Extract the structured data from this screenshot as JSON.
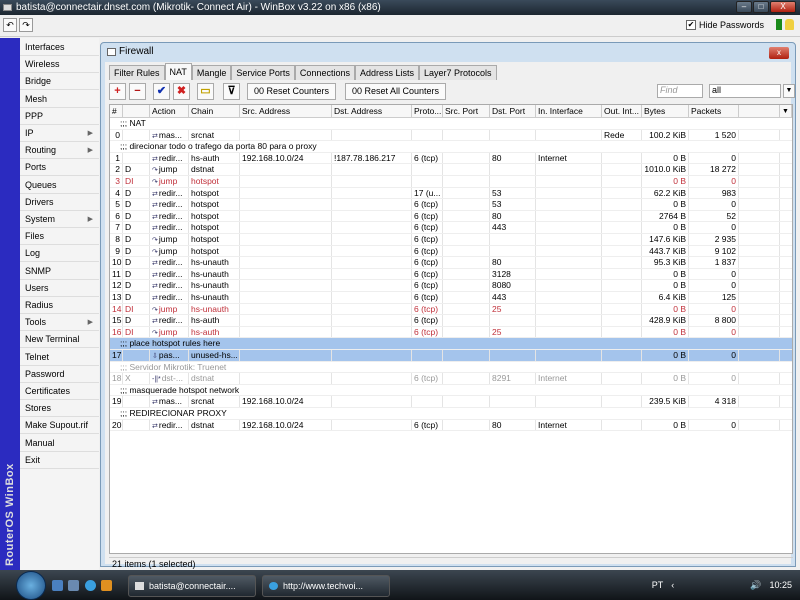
{
  "window": {
    "title": "batista@connectair.dnset.com (Mikrotik- Connect Air) - WinBox v3.22 on x86 (x86)",
    "minimize": "–",
    "maximize": "□",
    "close": "X"
  },
  "topbar": {
    "undo": "↶",
    "redo": "↷",
    "hide_passwords_label": "Hide Passwords",
    "hide_passwords_checked": true,
    "check_mark": "✔"
  },
  "vertical_brand": "RouterOS WinBox",
  "sidebar": {
    "items": [
      {
        "label": "Interfaces"
      },
      {
        "label": "Wireless"
      },
      {
        "label": "Bridge"
      },
      {
        "label": "Mesh"
      },
      {
        "label": "PPP"
      },
      {
        "label": "IP",
        "submenu": true
      },
      {
        "label": "Routing",
        "submenu": true
      },
      {
        "label": "Ports"
      },
      {
        "label": "Queues"
      },
      {
        "label": "Drivers"
      },
      {
        "label": "System",
        "submenu": true
      },
      {
        "label": "Files"
      },
      {
        "label": "Log"
      },
      {
        "label": "SNMP"
      },
      {
        "label": "Users"
      },
      {
        "label": "Radius"
      },
      {
        "label": "Tools",
        "submenu": true
      },
      {
        "label": "New Terminal"
      },
      {
        "label": "Telnet"
      },
      {
        "label": "Password"
      },
      {
        "label": "Certificates"
      },
      {
        "label": "Stores"
      },
      {
        "label": "Make Supout.rif"
      },
      {
        "label": "Manual"
      },
      {
        "label": "Exit"
      }
    ],
    "submenu_arrow": "▶"
  },
  "firewall": {
    "title": "Firewall",
    "close": "x",
    "tabs": [
      {
        "label": "Filter Rules"
      },
      {
        "label": "NAT",
        "active": true
      },
      {
        "label": "Mangle"
      },
      {
        "label": "Service Ports"
      },
      {
        "label": "Connections"
      },
      {
        "label": "Address Lists"
      },
      {
        "label": "Layer7 Protocols"
      }
    ],
    "toolbar": {
      "add": "+",
      "remove": "−",
      "enable": "✔",
      "disable": "✖",
      "comment": "▭",
      "filter": "⊽",
      "reset_counters": "00 Reset Counters",
      "reset_all_counters": "00 Reset All Counters",
      "find_placeholder": "Find",
      "filter_value": "all",
      "filter_dropdown": "▼"
    },
    "columns": [
      "#",
      "",
      "Action",
      "Chain",
      "Src. Address",
      "Dst. Address",
      "Proto...",
      "Src. Port",
      "Dst. Port",
      "In. Interface",
      "Out. Int...",
      "Bytes",
      "Packets",
      "",
      "▼"
    ],
    "rows": [
      {
        "comment": ";;; NAT"
      },
      {
        "n": "0",
        "f": "",
        "a": "mas...",
        "ai": "⇄",
        "c": "srcnat",
        "src": "",
        "dst": "",
        "p": "",
        "sp": "",
        "dp": "",
        "ii": "",
        "oi": "Rede",
        "b": "100.2 KiB",
        "pk": "1 520"
      },
      {
        "comment": ";;; direcionar todo o trafego da porta 80 para o proxy"
      },
      {
        "n": "1",
        "f": "",
        "a": "redir...",
        "ai": "⇄",
        "c": "hs-auth",
        "src": "192.168.10.0/24",
        "dst": "!187.78.186.217",
        "p": "6 (tcp)",
        "sp": "",
        "dp": "80",
        "ii": "Internet",
        "oi": "",
        "b": "0 B",
        "pk": "0"
      },
      {
        "n": "2",
        "f": "D",
        "a": "jump",
        "ai": "↷",
        "c": "dstnat",
        "src": "",
        "dst": "",
        "p": "",
        "sp": "",
        "dp": "",
        "ii": "",
        "oi": "",
        "b": "1010.0 KiB",
        "pk": "18 272"
      },
      {
        "n": "3",
        "f": "DI",
        "a": "jump",
        "ai": "↷",
        "c": "hotspot",
        "src": "",
        "dst": "",
        "p": "",
        "sp": "",
        "dp": "",
        "ii": "",
        "oi": "",
        "b": "0 B",
        "pk": "0",
        "state": "disabled"
      },
      {
        "n": "4",
        "f": "D",
        "a": "redir...",
        "ai": "⇄",
        "c": "hotspot",
        "src": "",
        "dst": "",
        "p": "17 (u...",
        "sp": "",
        "dp": "53",
        "ii": "",
        "oi": "",
        "b": "62.2 KiB",
        "pk": "983"
      },
      {
        "n": "5",
        "f": "D",
        "a": "redir...",
        "ai": "⇄",
        "c": "hotspot",
        "src": "",
        "dst": "",
        "p": "6 (tcp)",
        "sp": "",
        "dp": "53",
        "ii": "",
        "oi": "",
        "b": "0 B",
        "pk": "0"
      },
      {
        "n": "6",
        "f": "D",
        "a": "redir...",
        "ai": "⇄",
        "c": "hotspot",
        "src": "",
        "dst": "",
        "p": "6 (tcp)",
        "sp": "",
        "dp": "80",
        "ii": "",
        "oi": "",
        "b": "2764 B",
        "pk": "52"
      },
      {
        "n": "7",
        "f": "D",
        "a": "redir...",
        "ai": "⇄",
        "c": "hotspot",
        "src": "",
        "dst": "",
        "p": "6 (tcp)",
        "sp": "",
        "dp": "443",
        "ii": "",
        "oi": "",
        "b": "0 B",
        "pk": "0"
      },
      {
        "n": "8",
        "f": "D",
        "a": "jump",
        "ai": "↷",
        "c": "hotspot",
        "src": "",
        "dst": "",
        "p": "6 (tcp)",
        "sp": "",
        "dp": "",
        "ii": "",
        "oi": "",
        "b": "147.6 KiB",
        "pk": "2 935"
      },
      {
        "n": "9",
        "f": "D",
        "a": "jump",
        "ai": "↷",
        "c": "hotspot",
        "src": "",
        "dst": "",
        "p": "6 (tcp)",
        "sp": "",
        "dp": "",
        "ii": "",
        "oi": "",
        "b": "443.7 KiB",
        "pk": "9 102"
      },
      {
        "n": "10",
        "f": "D",
        "a": "redir...",
        "ai": "⇄",
        "c": "hs-unauth",
        "src": "",
        "dst": "",
        "p": "6 (tcp)",
        "sp": "",
        "dp": "80",
        "ii": "",
        "oi": "",
        "b": "95.3 KiB",
        "pk": "1 837"
      },
      {
        "n": "11",
        "f": "D",
        "a": "redir...",
        "ai": "⇄",
        "c": "hs-unauth",
        "src": "",
        "dst": "",
        "p": "6 (tcp)",
        "sp": "",
        "dp": "3128",
        "ii": "",
        "oi": "",
        "b": "0 B",
        "pk": "0"
      },
      {
        "n": "12",
        "f": "D",
        "a": "redir...",
        "ai": "⇄",
        "c": "hs-unauth",
        "src": "",
        "dst": "",
        "p": "6 (tcp)",
        "sp": "",
        "dp": "8080",
        "ii": "",
        "oi": "",
        "b": "0 B",
        "pk": "0"
      },
      {
        "n": "13",
        "f": "D",
        "a": "redir...",
        "ai": "⇄",
        "c": "hs-unauth",
        "src": "",
        "dst": "",
        "p": "6 (tcp)",
        "sp": "",
        "dp": "443",
        "ii": "",
        "oi": "",
        "b": "6.4 KiB",
        "pk": "125"
      },
      {
        "n": "14",
        "f": "DI",
        "a": "jump",
        "ai": "↷",
        "c": "hs-unauth",
        "src": "",
        "dst": "",
        "p": "6 (tcp)",
        "sp": "",
        "dp": "25",
        "ii": "",
        "oi": "",
        "b": "0 B",
        "pk": "0",
        "state": "disabled"
      },
      {
        "n": "15",
        "f": "D",
        "a": "redir...",
        "ai": "⇄",
        "c": "hs-auth",
        "src": "",
        "dst": "",
        "p": "6 (tcp)",
        "sp": "",
        "dp": "",
        "ii": "",
        "oi": "",
        "b": "428.9 KiB",
        "pk": "8 800"
      },
      {
        "n": "16",
        "f": "DI",
        "a": "jump",
        "ai": "↷",
        "c": "hs-auth",
        "src": "",
        "dst": "",
        "p": "6 (tcp)",
        "sp": "",
        "dp": "25",
        "ii": "",
        "oi": "",
        "b": "0 B",
        "pk": "0",
        "state": "disabled"
      },
      {
        "comment": ";;; place hotspot rules here",
        "state": "selected"
      },
      {
        "n": "17",
        "f": "",
        "a": "pas...",
        "ai": "⇩",
        "c": "unused-hs...",
        "src": "",
        "dst": "",
        "p": "",
        "sp": "",
        "dp": "",
        "ii": "",
        "oi": "",
        "b": "0 B",
        "pk": "0",
        "state": "selected"
      },
      {
        "comment": ";;; Servidor Mikrotik: Truenet",
        "state": "x"
      },
      {
        "n": "18",
        "f": "X",
        "a": "dst-...",
        "ai": "-||*",
        "c": "dstnat",
        "src": "",
        "dst": "",
        "p": "6 (tcp)",
        "sp": "",
        "dp": "8291",
        "ii": "Internet",
        "oi": "",
        "b": "0 B",
        "pk": "0",
        "state": "x"
      },
      {
        "comment": ";;; masquerade hotspot network"
      },
      {
        "n": "19",
        "f": "",
        "a": "mas...",
        "ai": "⇄",
        "c": "srcnat",
        "src": "192.168.10.0/24",
        "dst": "",
        "p": "",
        "sp": "",
        "dp": "",
        "ii": "",
        "oi": "",
        "b": "239.5 KiB",
        "pk": "4 318"
      },
      {
        "comment": ";;; REDIRECIONAR PROXY"
      },
      {
        "n": "20",
        "f": "",
        "a": "redir...",
        "ai": "⇄",
        "c": "dstnat",
        "src": "192.168.10.0/24",
        "dst": "",
        "p": "6 (tcp)",
        "sp": "",
        "dp": "80",
        "ii": "Internet",
        "oi": "",
        "b": "0 B",
        "pk": "0"
      }
    ],
    "status": "21 items (1 selected)"
  },
  "taskbar": {
    "tasks": [
      {
        "label": "batista@connectair...."
      },
      {
        "label": "http://www.techvoi..."
      }
    ],
    "language": "PT",
    "tray_arrow": "‹",
    "volume": "🔊",
    "clock": "10:25"
  },
  "colors": {
    "disabled": "#c0303a",
    "selected": "#a4c4ec",
    "sidebar_bar": "#2b2bc0"
  }
}
